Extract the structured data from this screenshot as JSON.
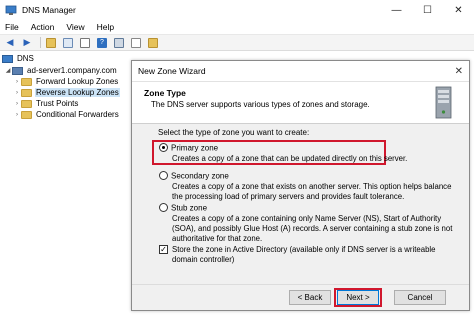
{
  "window": {
    "title": "DNS Manager",
    "controls": {
      "minimize": "—",
      "maximize": "☐",
      "close": "✕"
    }
  },
  "menu": {
    "items": [
      "File",
      "Action",
      "View",
      "Help"
    ]
  },
  "toolbar": {
    "icons": [
      "back-icon",
      "forward-icon",
      "folder-up-icon",
      "console-tree-icon",
      "properties-icon",
      "help-icon",
      "server-icon",
      "copy-icon",
      "refresh-icon"
    ]
  },
  "tree": {
    "root": "DNS",
    "server": "ad-server1.company.com",
    "items": [
      "Forward Lookup Zones",
      "Reverse Lookup Zones",
      "Trust Points",
      "Conditional Forwarders"
    ]
  },
  "wizard": {
    "title": "New Zone Wizard",
    "close": "✕",
    "header_title": "Zone Type",
    "header_subtitle": "The DNS server supports various types of zones and storage.",
    "prompt": "Select the type of zone you want to create:",
    "options": [
      {
        "label": "Primary zone",
        "desc": "Creates a copy of a zone that can be updated directly on this server.",
        "checked": true
      },
      {
        "label": "Secondary zone",
        "desc": "Creates a copy of a zone that exists on another server. This option helps balance the processing load of primary servers and provides fault tolerance.",
        "checked": false
      },
      {
        "label": "Stub zone",
        "desc": "Creates a copy of a zone containing only Name Server (NS), Start of Authority (SOA), and possibly Glue Host (A) records. A server containing a stub zone is not authoritative for that zone.",
        "checked": false
      }
    ],
    "store_ad": {
      "label": "Store the zone in Active Directory (available only if DNS server is a writeable domain controller)",
      "checked": true
    },
    "buttons": {
      "back": "< Back",
      "next": "Next >",
      "cancel": "Cancel"
    }
  },
  "colors": {
    "highlight": "#d0172d",
    "selection": "#cce4f7",
    "folder": "#e6c25a"
  }
}
